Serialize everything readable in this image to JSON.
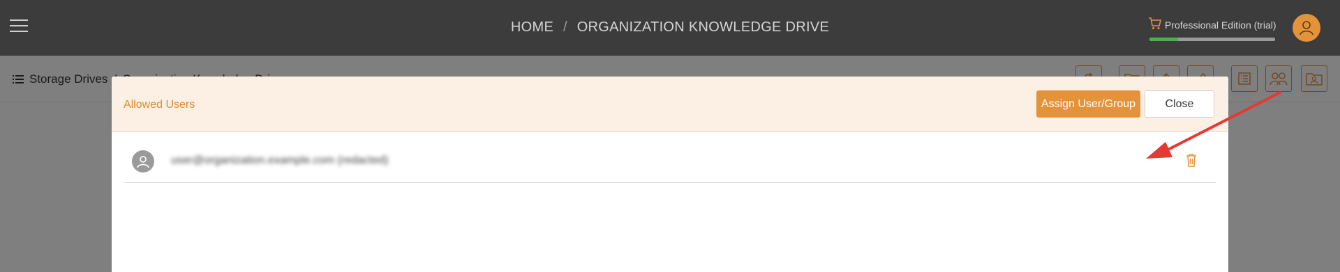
{
  "header": {
    "breadcrumb_home": "HOME",
    "breadcrumb_sep": "/",
    "breadcrumb_current": "ORGANIZATION KNOWLEDGE DRIVE",
    "edition_label": "Professional Edition (trial)",
    "trial_progress": 0.23
  },
  "subbar": {
    "breadcrumb_root": "Storage Drives",
    "breadcrumb_sep": "/",
    "breadcrumb_current": "Organization Knowledge Drive"
  },
  "modal": {
    "title": "Allowed Users",
    "assign_label": "Assign User/Group",
    "close_label": "Close",
    "users": [
      {
        "name": "user@organization.example.com (redacted)"
      }
    ]
  },
  "colors": {
    "accent": "#e5933a",
    "topbar": "#3c3c3c",
    "progress": "#4caf50",
    "annotation_arrow": "#e53935"
  },
  "icons": [
    "menu-icon",
    "cart-icon",
    "user-avatar-icon",
    "list-icon",
    "refresh-icon",
    "folder-icon",
    "upload-icon",
    "edit-icon",
    "details-icon",
    "users-icon",
    "folder-users-icon",
    "person-icon",
    "trash-icon"
  ]
}
